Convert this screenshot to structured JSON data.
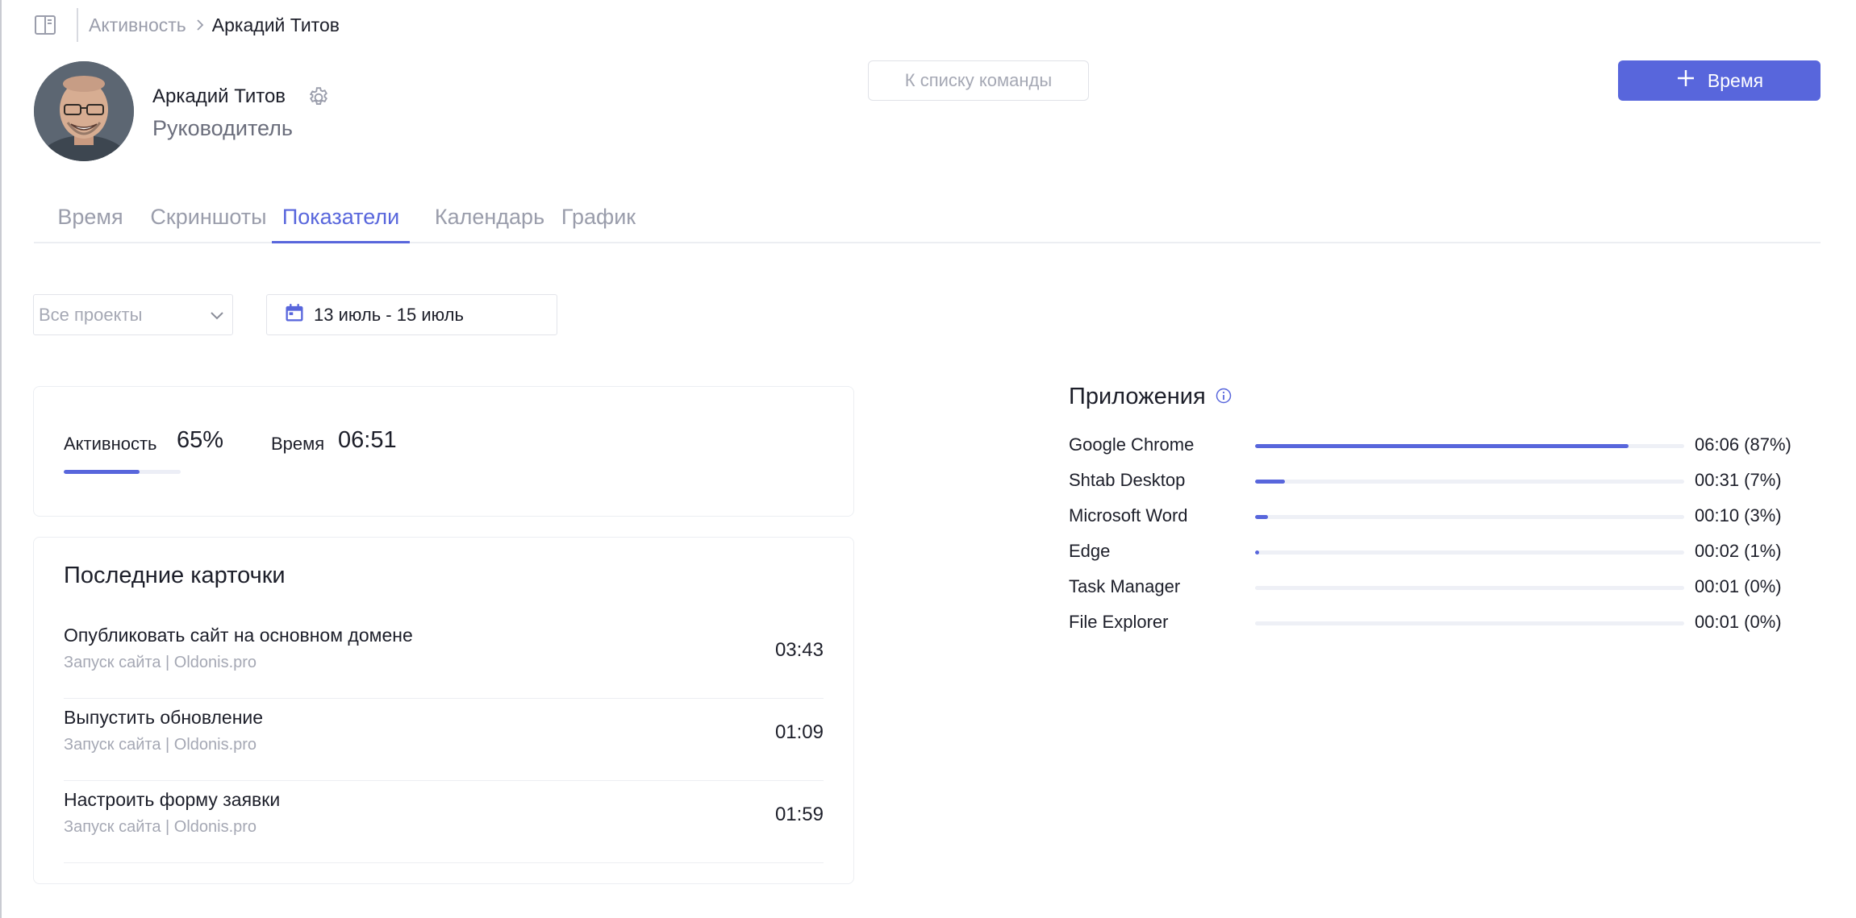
{
  "breadcrumb": {
    "parent": "Активность",
    "current": "Аркадий Титов"
  },
  "user": {
    "name": "Аркадий Титов",
    "role": "Руководитель"
  },
  "buttons": {
    "team_list": "К списку команды",
    "add_time": "Время"
  },
  "tabs": [
    {
      "label": "Время",
      "active": false
    },
    {
      "label": "Скриншоты",
      "active": false
    },
    {
      "label": "Показатели",
      "active": true
    },
    {
      "label": "Календарь",
      "active": false
    },
    {
      "label": "График",
      "active": false
    }
  ],
  "filters": {
    "project_placeholder": "Все проекты",
    "date_range": "13 июль - 15 июль"
  },
  "summary": {
    "activity_label": "Активность",
    "activity_value": "65%",
    "activity_fraction": 0.65,
    "time_label": "Время",
    "time_value": "06:51"
  },
  "recent_cards": {
    "title": "Последние карточки",
    "items": [
      {
        "title": "Опубликовать сайт на основном домене",
        "subtitle": "Запуск сайта | Oldonis.pro",
        "time": "03:43"
      },
      {
        "title": "Выпустить обновление",
        "subtitle": "Запуск сайта | Oldonis.pro",
        "time": "01:09"
      },
      {
        "title": "Настроить форму заявки",
        "subtitle": "Запуск сайта | Oldonis.pro",
        "time": "01:59"
      }
    ]
  },
  "apps": {
    "title": "Приложения",
    "items": [
      {
        "name": "Google Chrome",
        "time": "06:06 (87%)",
        "fraction": 0.87
      },
      {
        "name": "Shtab Desktop",
        "time": "00:31 (7%)",
        "fraction": 0.07
      },
      {
        "name": "Microsoft Word",
        "time": "00:10 (3%)",
        "fraction": 0.03
      },
      {
        "name": "Edge",
        "time": "00:02 (1%)",
        "fraction": 0.01
      },
      {
        "name": "Task Manager",
        "time": "00:01 (0%)",
        "fraction": 0.0
      },
      {
        "name": "File Explorer",
        "time": "00:01 (0%)",
        "fraction": 0.0
      }
    ]
  },
  "colors": {
    "accent": "#5866dc",
    "muted": "#9a9dab",
    "text": "#1c1e29",
    "border": "#eceef2"
  },
  "icons": {
    "sidebar_toggle": "sidebar-toggle-icon",
    "breadcrumb_chevron": "chevron-right-icon",
    "settings": "gear-icon",
    "add": "plus-icon",
    "dropdown": "chevron-down-icon",
    "calendar": "calendar-icon",
    "info": "info-icon"
  }
}
